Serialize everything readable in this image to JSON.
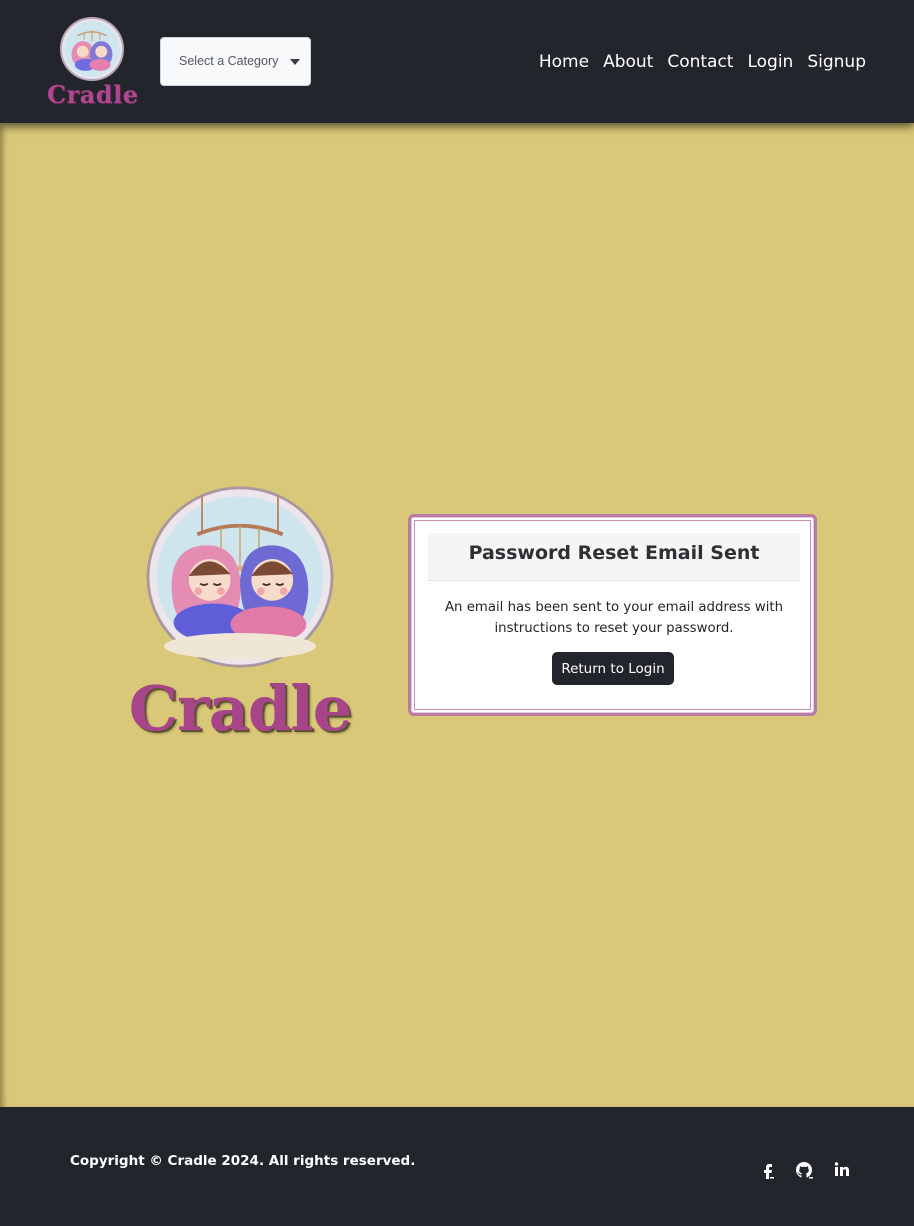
{
  "header": {
    "brand_name": "Cradle",
    "category_select": {
      "value": "Select a Category"
    },
    "nav": [
      {
        "label": "Home"
      },
      {
        "label": "About"
      },
      {
        "label": "Contact"
      },
      {
        "label": "Login"
      },
      {
        "label": "Signup"
      }
    ]
  },
  "main": {
    "logo_word": "Cradle",
    "card": {
      "title": "Password Reset Email Sent",
      "message": "An email has been sent to your email address with instructions to reset your password.",
      "button_label": "Return to Login"
    }
  },
  "footer": {
    "copyright": "Copyright © Cradle 2024. All rights reserved.",
    "social_icons": [
      "facebook-icon",
      "github-icon",
      "linkedin-icon"
    ]
  },
  "colors": {
    "page_background": "#d9c877",
    "navbar": "#22252b",
    "brand_magenta": "#a8458a",
    "card_border": "#b97aa6"
  }
}
